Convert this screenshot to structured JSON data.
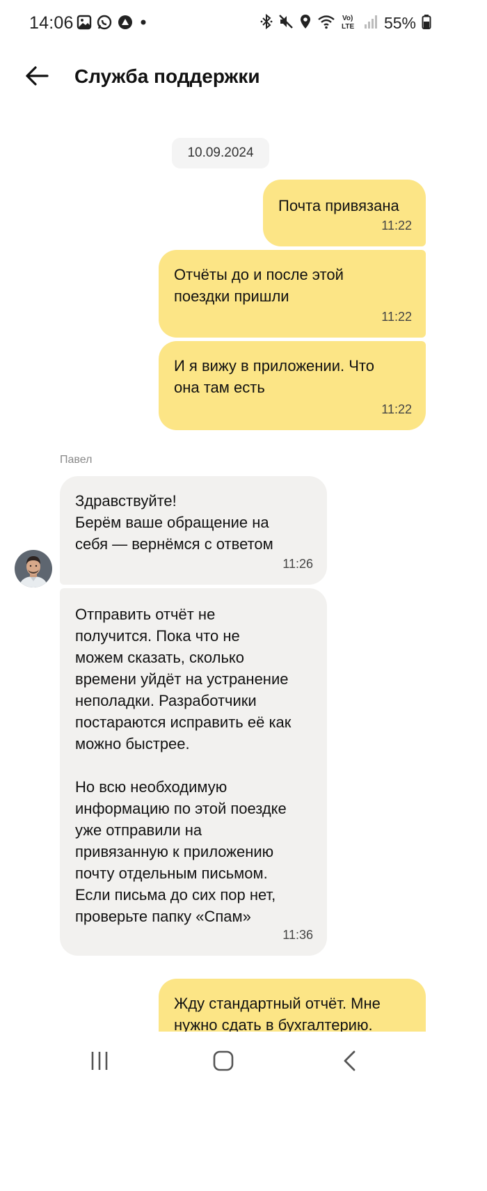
{
  "status_bar": {
    "time": "14:06",
    "battery_percent": "55%",
    "network_label": "Vo) LTE",
    "left_icons": [
      "gallery-icon",
      "whatsapp-icon",
      "app-notification-icon",
      "dot-icon"
    ],
    "right_icons": [
      "bluetooth-icon",
      "mute-icon",
      "location-icon",
      "wifi-icon",
      "volte-icon",
      "signal-icon",
      "battery-icon"
    ]
  },
  "header": {
    "title": "Служба поддержки"
  },
  "chat": {
    "date": "10.09.2024",
    "outgoing_1": {
      "text": "Почта привязана",
      "time": "11:22"
    },
    "outgoing_2": {
      "text": "Отчёты до и после этой\nпоездки пришли",
      "time": "11:22"
    },
    "outgoing_3": {
      "text": "И я вижу в приложении. Что\nона там есть",
      "time": "11:22"
    },
    "agent_name": "Павел",
    "incoming_1": {
      "text": "Здравствуйте!\nБерём ваше обращение на\nсебя — вернёмся с ответом",
      "time": "11:26"
    },
    "incoming_2": {
      "text": "Отправить отчёт не\nполучится. Пока что не\nможем сказать, сколько\nвремени уйдёт на устранение\nнеполадки. Разработчики\nпостараются исправить её как\nможно быстрее.\n\nНо всю необходимую\nинформацию по этой поездке\nуже отправили на\nпривязанную к приложению\nпочту отдельным письмом.\nЕсли письма до сих пор нет,\nпроверьте папку «Спам»",
      "time": "11:36"
    },
    "outgoing_4": {
      "text": "Жду стандартный отчёт. Мне\nнужно сдать в бухгалтерию."
    }
  },
  "colors": {
    "outgoing_bubble": "#fce586",
    "incoming_bubble": "#f2f1ef",
    "date_pill": "#f4f4f4"
  },
  "nav_bar": {
    "icons": [
      "recent-apps-icon",
      "home-icon",
      "back-nav-icon"
    ]
  }
}
